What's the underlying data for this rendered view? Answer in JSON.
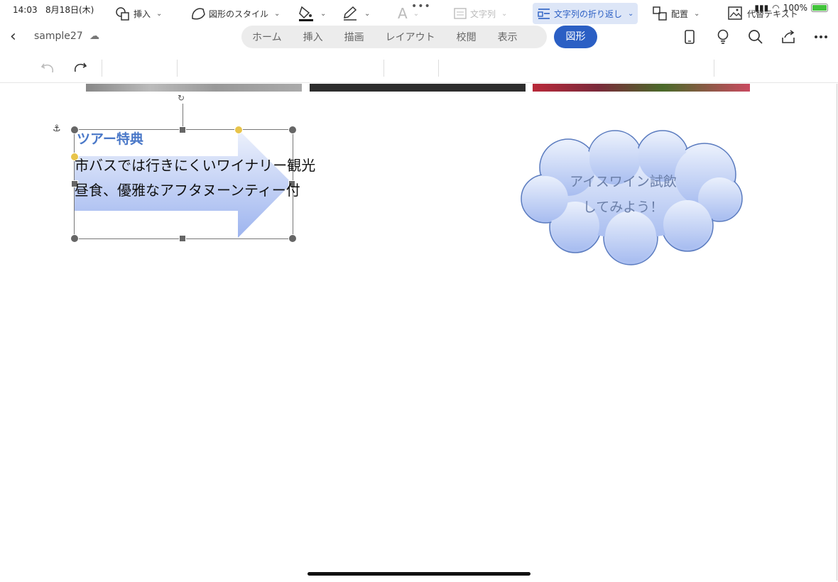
{
  "status": {
    "time": "14:03",
    "date": "8月18日(木)",
    "battery": "100%"
  },
  "doc": {
    "name": "sample27"
  },
  "tabs": [
    "ホーム",
    "挿入",
    "描画",
    "レイアウト",
    "校閲",
    "表示"
  ],
  "active_tab": "図形",
  "toolbar": {
    "insert": "挿入",
    "shape_style": "図形のスタイル",
    "text": "文字列",
    "wrap": "文字列の折り返し",
    "arrange": "配置",
    "alt_text": "代替テキスト"
  },
  "content": {
    "heading": "ツアー特典",
    "line1": "市バスでは行きにくいワイナリー観光",
    "line2": "昼食、優雅なアフタヌーンティー付",
    "cloud_line1": "アイスワイン試飲",
    "cloud_line2": "してみよう！"
  },
  "colors": {
    "accent": "#2b5fc4",
    "heading": "#4a78c8",
    "shape_fill_top": "#e6ecfb",
    "shape_fill_bottom": "#9fb5ef"
  },
  "icons": [
    "back-icon",
    "cloud-sync-icon",
    "phone-icon",
    "lightbulb-icon",
    "search-icon",
    "share-icon",
    "more-icon",
    "undo-icon",
    "redo-icon",
    "shapes-icon",
    "shape-style-icon",
    "fill-icon",
    "pen-icon",
    "text-effect-icon",
    "text-box-icon",
    "wrap-icon",
    "arrange-icon",
    "alt-text-icon",
    "anchor-icon",
    "rotate-icon"
  ]
}
